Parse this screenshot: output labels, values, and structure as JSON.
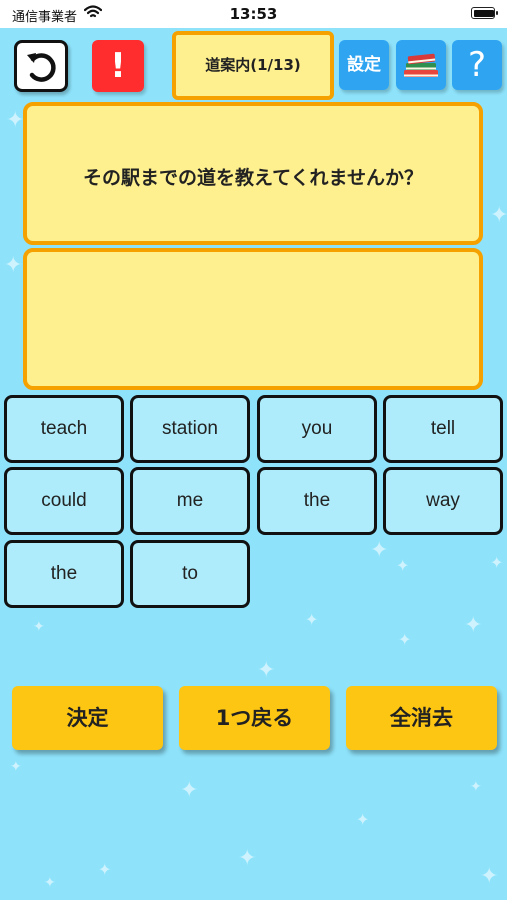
{
  "status_bar": {
    "carrier": "通信事業者",
    "time": "13:53",
    "battery_level": 1.0
  },
  "toolbar": {
    "undo_icon": "undo-arrow-icon",
    "alert_label": "!",
    "title": "道案内(1/13)",
    "settings_label": "設定",
    "books_icon": "books-icon",
    "help_label": "?"
  },
  "question": {
    "text": "その駅までの道を教えてくれませんか？"
  },
  "answer": {
    "text": ""
  },
  "word_tiles": [
    "teach",
    "station",
    "you",
    "tell",
    "could",
    "me",
    "the",
    "way",
    "the",
    "to"
  ],
  "actions": {
    "decide": "決定",
    "back_one": "1つ戻る",
    "clear_all": "全消去"
  },
  "colors": {
    "background": "#8ee3fb",
    "panel": "#fff08f",
    "panel_border": "#f5a100",
    "tile": "#aeecfb",
    "action": "#fdc613",
    "alert": "#ff2d2d",
    "toolbar_blue": "#2fa5f2"
  }
}
